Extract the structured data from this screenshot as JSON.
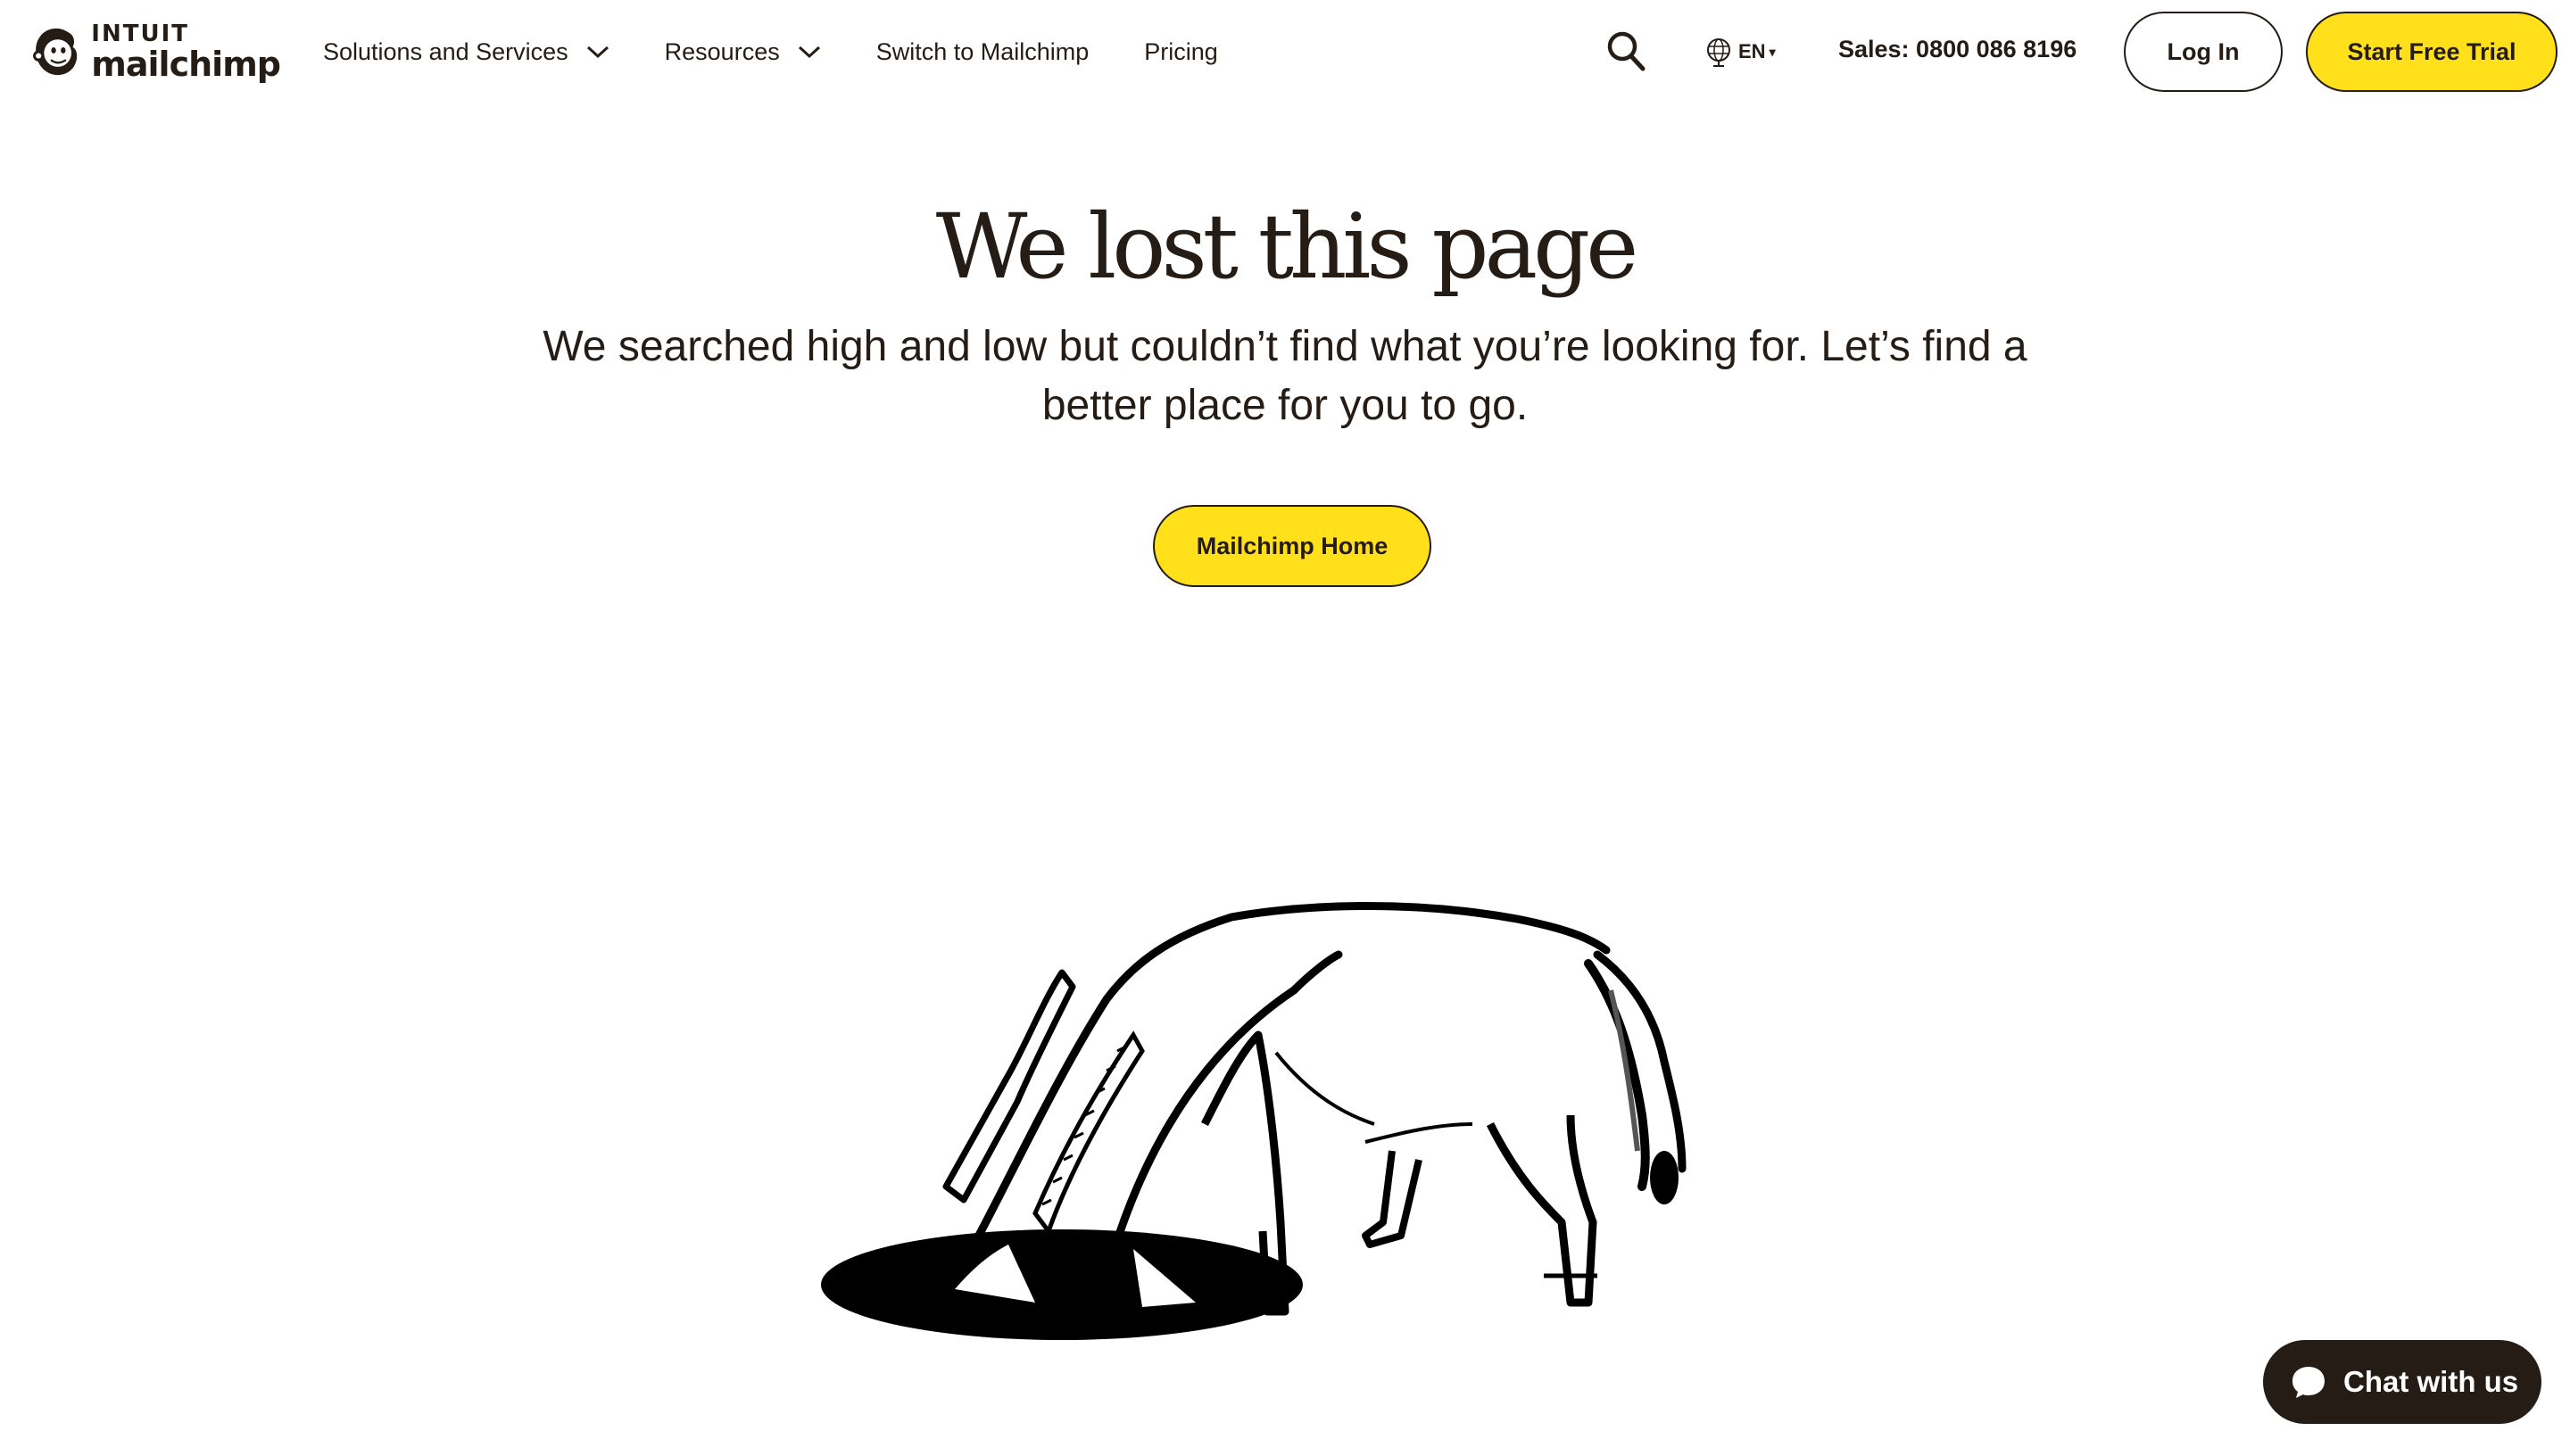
{
  "header": {
    "logo": {
      "line1": "INTUIT",
      "line2": "mailchimp"
    },
    "nav": [
      {
        "label": "Solutions and Services",
        "has_dropdown": true
      },
      {
        "label": "Resources",
        "has_dropdown": true
      },
      {
        "label": "Switch to Mailchimp",
        "has_dropdown": false
      },
      {
        "label": "Pricing",
        "has_dropdown": false
      }
    ],
    "language": "EN",
    "sales": "Sales: 0800 086 8196",
    "login_label": "Log In",
    "trial_label": "Start Free Trial"
  },
  "hero": {
    "title": "We lost this page",
    "subtitle": "We searched high and low but couldn’t find what you’re looking for. Let’s find a better place for you to go.",
    "home_button": "Mailchimp Home"
  },
  "chat": {
    "label": "Chat with us"
  },
  "colors": {
    "accent": "#ffe01b",
    "ink": "#241c15",
    "background": "#ffffff"
  },
  "icons": {
    "logo": "chimp-logo-icon",
    "search": "search-icon",
    "language": "globe-icon",
    "dropdown": "chevron-down-icon",
    "chat": "chat-bubble-icon",
    "illustration": "horse-head-in-hole-illustration"
  }
}
